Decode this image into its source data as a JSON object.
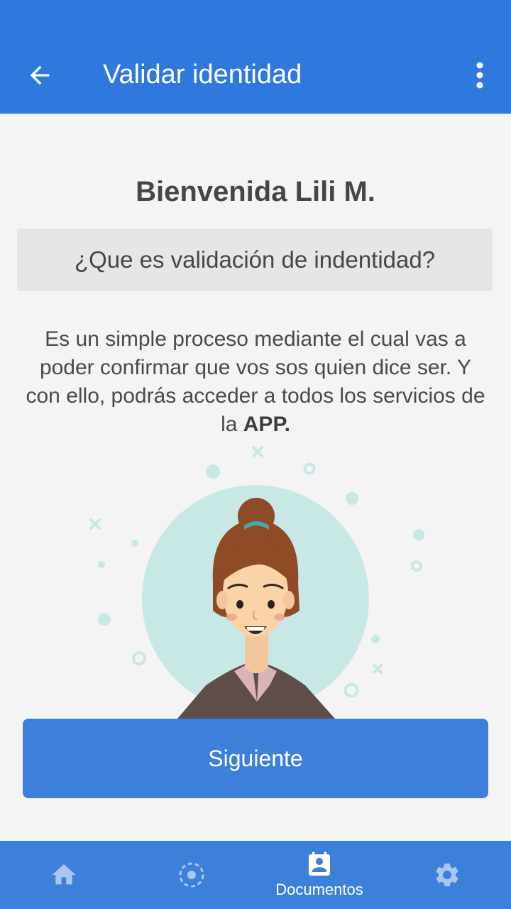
{
  "app_bar": {
    "title": "Validar identidad",
    "back_icon": "arrow-back-icon",
    "menu_icon": "more-vertical-icon",
    "background": "#2f78de"
  },
  "content": {
    "greeting": "Bienvenida Lili M.",
    "question": "¿Que es validación de indentidad?",
    "description_text": "Es un simple proceso mediante el cual vas a poder confirmar que vos sos quien dice ser. Y con ello, podrás acceder a todos los servicios de la ",
    "description_bold": "APP."
  },
  "primary_button": {
    "label": "Siguiente",
    "color": "#3d80d9"
  },
  "bottom_nav": {
    "items": [
      {
        "icon": "home-icon",
        "label": "",
        "active": false
      },
      {
        "icon": "scan-circle-icon",
        "label": "",
        "active": false
      },
      {
        "icon": "id-card-icon",
        "label": "Documentos",
        "active": true
      },
      {
        "icon": "settings-icon",
        "label": "",
        "active": false
      }
    ]
  }
}
